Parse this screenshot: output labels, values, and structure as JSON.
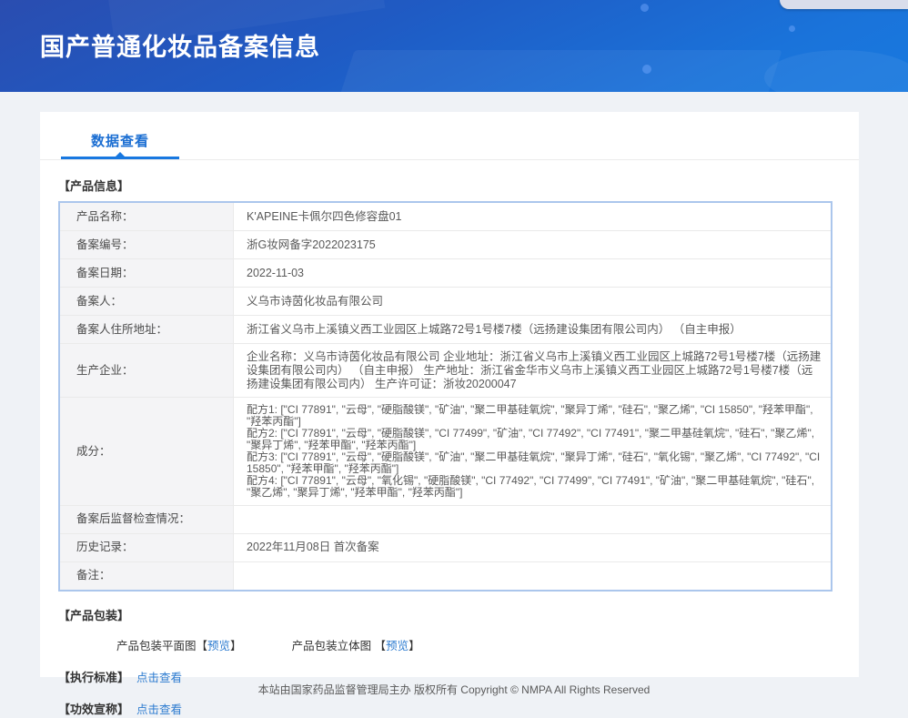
{
  "header": {
    "title": "国产普通化妆品备案信息"
  },
  "tab": {
    "label": "数据查看"
  },
  "product_info": {
    "section_title": "【产品信息】",
    "rows": [
      {
        "label": "产品名称：",
        "value": "K'APEINE卡佩尔四色修容盘01"
      },
      {
        "label": "备案编号：",
        "value": "浙G妆网备字2022023175"
      },
      {
        "label": "备案日期：",
        "value": "2022-11-03"
      },
      {
        "label": "备案人：",
        "value": "义乌市诗茵化妆品有限公司"
      },
      {
        "label": "备案人住所地址：",
        "value": "浙江省义乌市上溪镇义西工业园区上城路72号1号楼7楼（远扬建设集团有限公司内） （自主申报）"
      },
      {
        "label": "生产企业：",
        "value": "企业名称：义乌市诗茵化妆品有限公司 企业地址：浙江省义乌市上溪镇义西工业园区上城路72号1号楼7楼（远扬建设集团有限公司内） （自主申报） 生产地址：浙江省金华市义乌市上溪镇义西工业园区上城路72号1号楼7楼（远扬建设集团有限公司内） 生产许可证：浙妆20200047"
      },
      {
        "label": "成分：",
        "lines": [
          "配方1: [\"CI 77891\", \"云母\", \"硬脂酸镁\", \"矿油\", \"聚二甲基硅氧烷\", \"聚异丁烯\", \"硅石\", \"聚乙烯\", \"CI 15850\", \"羟苯甲酯\", \"羟苯丙酯\"]",
          "配方2: [\"CI 77891\", \"云母\", \"硬脂酸镁\", \"CI 77499\", \"矿油\", \"CI 77492\", \"CI 77491\", \"聚二甲基硅氧烷\", \"硅石\", \"聚乙烯\", \"聚异丁烯\", \"羟苯甲酯\", \"羟苯丙酯\"]",
          "配方3: [\"CI 77891\", \"云母\", \"硬脂酸镁\", \"矿油\", \"聚二甲基硅氧烷\", \"聚异丁烯\", \"硅石\", \"氧化锡\", \"聚乙烯\", \"CI 77492\", \"CI 15850\", \"羟苯甲酯\", \"羟苯丙酯\"]",
          "配方4: [\"CI 77891\", \"云母\", \"氧化锡\", \"硬脂酸镁\", \"CI 77492\", \"CI 77499\", \"CI 77491\", \"矿油\", \"聚二甲基硅氧烷\", \"硅石\", \"聚乙烯\", \"聚异丁烯\", \"羟苯甲酯\", \"羟苯丙酯\"]"
        ]
      },
      {
        "label": "备案后监督检查情况：",
        "value": ""
      },
      {
        "label": "历史记录：",
        "value": "2022年11月08日 首次备案"
      },
      {
        "label": "备注：",
        "value": ""
      }
    ]
  },
  "packaging": {
    "section_title": "【产品包装】",
    "flat_label": "产品包装平面图",
    "flat_bracket_open": "【",
    "flat_link": "预览",
    "flat_bracket_close": "】",
    "stereo_label": "产品包装立体图 ",
    "stereo_bracket_open": "【",
    "stereo_link": "预览",
    "stereo_bracket_close": "】"
  },
  "standard": {
    "label": "【执行标准】",
    "link": "点击查看"
  },
  "efficacy": {
    "label": "【功效宣称】",
    "link": "点击查看"
  },
  "footer": {
    "text": "本站由国家药品监督管理局主办 版权所有 Copyright © NMPA All Rights Reserved"
  },
  "colors": {
    "header_gradient_start": "#2a4db0",
    "header_gradient_end": "#1879df",
    "accent_blue": "#1878e0",
    "tab_text": "#1b6ed2",
    "link": "#2e7cd0",
    "table_border": "#abc6ec",
    "label_cell_bg": "#f4f4f6",
    "page_bg": "#eff2f6"
  }
}
